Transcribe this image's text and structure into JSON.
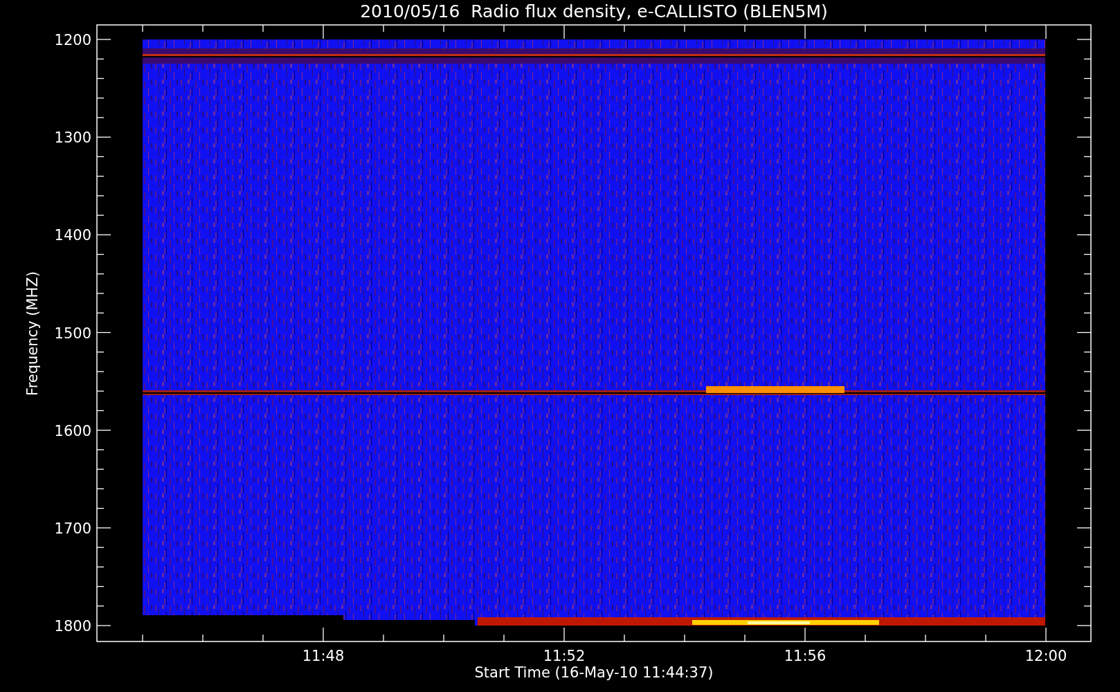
{
  "title": "2010/05/16  Radio flux density, e-CALLISTO (BLEN5M)",
  "y_axis": {
    "label": "Frequency (MHZ)",
    "ticks": [
      "1200",
      "1300",
      "1400",
      "1500",
      "1600",
      "1700",
      "1800"
    ]
  },
  "x_axis": {
    "label": "Start Time (16-May-10 11:44:37)",
    "ticks": [
      "11:48",
      "11:52",
      "11:56",
      "12:00"
    ]
  }
}
